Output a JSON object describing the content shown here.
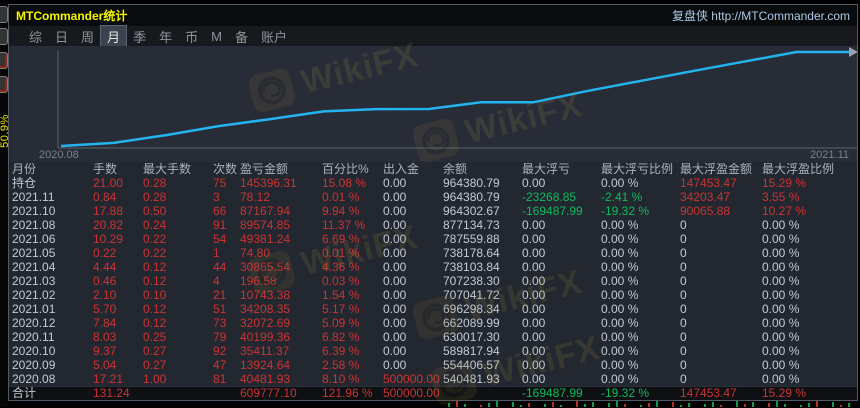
{
  "window": {
    "title": "MTCommander统计",
    "link": "复盘侠 http://MTCommander.com",
    "menu": {
      "items": [
        "综",
        "日",
        "周",
        "月",
        "季",
        "年",
        "币",
        "M",
        "备",
        "账户"
      ],
      "selected": "月"
    }
  },
  "side_label": "50.9%",
  "watermark": {
    "text": "WikiFX"
  },
  "chart_data": {
    "type": "line",
    "title": "",
    "xlabel": "",
    "ylabel": "",
    "x": [
      "2020.08",
      "2020.09",
      "2020.10",
      "2020.11",
      "2020.12",
      "2021.01",
      "2021.02",
      "2021.03",
      "2021.04",
      "2021.05",
      "2021.06",
      "2021.08",
      "2021.10",
      "2021.11"
    ],
    "balances": [
      540481.93,
      554406.57,
      589817.94,
      630017.3,
      662089.99,
      696298.34,
      707041.72,
      707238.3,
      738103.84,
      738178.64,
      787559.88,
      877134.73,
      964302.67,
      964380.79
    ],
    "x_tick_labels": [
      "2020.08",
      "2021.11"
    ],
    "x_range": [
      "2020.08",
      "2021.11"
    ],
    "grid": false,
    "legend": "none",
    "line_color": "#23b3ef"
  },
  "table": {
    "headers": [
      "月份",
      "手数",
      "最大手数",
      "次数",
      "盈亏金额",
      "百分比%",
      "出入金",
      "余额",
      "最大浮亏",
      "最大浮亏比例",
      "最大浮盈金额",
      "最大浮盈比例"
    ],
    "rows": [
      [
        "持仓",
        "21.00",
        "0.28",
        "75",
        "145396.31",
        "15.08 %",
        "0.00",
        "964380.79",
        "0.00",
        "0.00 %",
        "147453.47",
        "15.29 %"
      ],
      [
        "2021.11",
        "0.84",
        "0.28",
        "3",
        "78.12",
        "0.01 %",
        "0.00",
        "964380.79",
        "-23268.85",
        "-2.41 %",
        "34203.47",
        "3.55 %"
      ],
      [
        "2021.10",
        "17.88",
        "0.50",
        "66",
        "87167.94",
        "9.94 %",
        "0.00",
        "964302.67",
        "-169487.99",
        "-19.32 %",
        "90065.88",
        "10.27 %"
      ],
      [
        "2021.08",
        "20.82",
        "0.24",
        "91",
        "89574.85",
        "11.37 %",
        "0.00",
        "877134.73",
        "0.00",
        "0.00 %",
        "0",
        "0.00 %"
      ],
      [
        "2021.06",
        "10.29",
        "0.22",
        "54",
        "49381.24",
        "6.69 %",
        "0.00",
        "787559.88",
        "0.00",
        "0.00 %",
        "0",
        "0.00 %"
      ],
      [
        "2021.05",
        "0.22",
        "0.22",
        "1",
        "74.80",
        "0.01 %",
        "0.00",
        "738178.64",
        "0.00",
        "0.00 %",
        "0",
        "0.00 %"
      ],
      [
        "2021.04",
        "4.44",
        "0.12",
        "44",
        "30865.54",
        "4.36 %",
        "0.00",
        "738103.84",
        "0.00",
        "0.00 %",
        "0",
        "0.00 %"
      ],
      [
        "2021.03",
        "0.46",
        "0.12",
        "4",
        "196.58",
        "0.03 %",
        "0.00",
        "707238.30",
        "0.00",
        "0.00 %",
        "0",
        "0.00 %"
      ],
      [
        "2021.02",
        "2.10",
        "0.10",
        "21",
        "10743.38",
        "1.54 %",
        "0.00",
        "707041.72",
        "0.00",
        "0.00 %",
        "0",
        "0.00 %"
      ],
      [
        "2021.01",
        "5.70",
        "0.12",
        "51",
        "34208.35",
        "5.17 %",
        "0.00",
        "696298.34",
        "0.00",
        "0.00 %",
        "0",
        "0.00 %"
      ],
      [
        "2020.12",
        "7.84",
        "0.12",
        "73",
        "32072.69",
        "5.09 %",
        "0.00",
        "662089.99",
        "0.00",
        "0.00 %",
        "0",
        "0.00 %"
      ],
      [
        "2020.11",
        "8.03",
        "0.25",
        "79",
        "40199.36",
        "6.82 %",
        "0.00",
        "630017.30",
        "0.00",
        "0.00 %",
        "0",
        "0.00 %"
      ],
      [
        "2020.10",
        "9.37",
        "0.27",
        "92",
        "35411.37",
        "6.39 %",
        "0.00",
        "589817.94",
        "0.00",
        "0.00 %",
        "0",
        "0.00 %"
      ],
      [
        "2020.09",
        "5.04",
        "0.27",
        "47",
        "13924.64",
        "2.58 %",
        "0.00",
        "554406.57",
        "0.00",
        "0.00 %",
        "0",
        "0.00 %"
      ],
      [
        "2020.08",
        "17.21",
        "1.00",
        "81",
        "40481.93",
        "8.10 %",
        "500000.00",
        "540481.93",
        "0.00",
        "0.00 %",
        "0",
        "0.00 %"
      ]
    ],
    "total_row": [
      "合计",
      "131.24",
      "",
      "",
      "609777.10",
      "121.96 %",
      "500000.00",
      "",
      "-169487.99",
      "-19.32 %",
      "147453.47",
      "15.29 %"
    ]
  },
  "colors": {
    "red": "#cb3434",
    "green": "#0dba5f",
    "text": "#c2cbd4",
    "header": "#a9b3bd",
    "line": "#23b3ef",
    "title_yellow": "#f5f500",
    "link_blue": "#a9c9e6"
  }
}
